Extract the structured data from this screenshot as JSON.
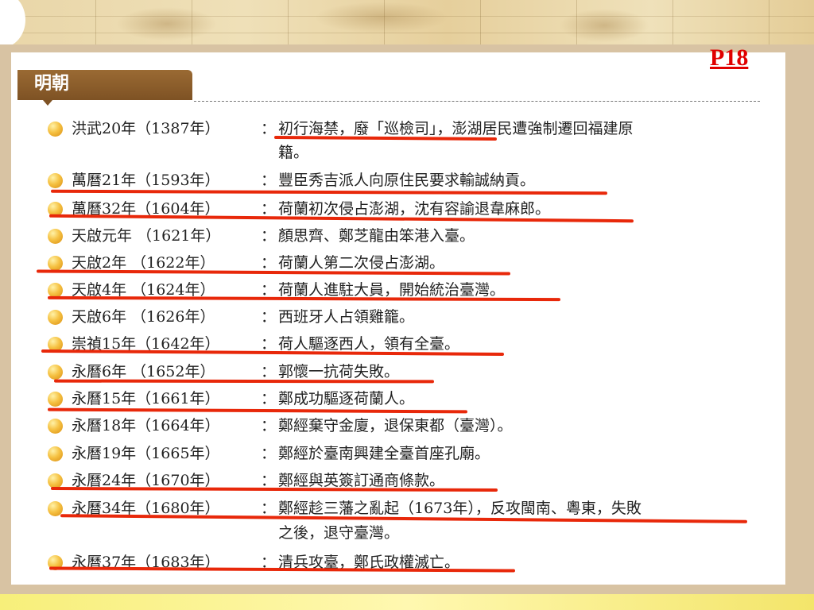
{
  "page_number": "P18",
  "section_title": "明朝",
  "colors": {
    "accent_red": "#e8280a",
    "tab_brown": "#8a5c2a",
    "bullet": "#f2b636"
  },
  "events": [
    {
      "date": "洪武20年（1387年）",
      "description": "初行海禁，廢「巡檢司」，澎湖居民遭強制遷回福建原",
      "continuation": "籍。"
    },
    {
      "date": "萬曆21年（1593年）",
      "description": "豐臣秀吉派人向原住民要求輸誠納貢。"
    },
    {
      "date": "萬曆32年（1604年）",
      "description": "荷蘭初次侵占澎湖，沈有容諭退韋麻郎。"
    },
    {
      "date": "天啟元年 （1621年）",
      "description": "顏思齊、鄭芝龍由笨港入臺。"
    },
    {
      "date": "天啟2年 （1622年）",
      "description": "荷蘭人第二次侵占澎湖。"
    },
    {
      "date": "天啟4年 （1624年）",
      "description": "荷蘭人進駐大員，開始統治臺灣。"
    },
    {
      "date": "天啟6年 （1626年）",
      "description": "西班牙人占領雞籠。"
    },
    {
      "date": "崇禎15年（1642年）",
      "description": "荷人驅逐西人，領有全臺。"
    },
    {
      "date": "永曆6年 （1652年）",
      "description": "郭懷一抗荷失敗。"
    },
    {
      "date": "永曆15年（1661年）",
      "description": "鄭成功驅逐荷蘭人。"
    },
    {
      "date": "永曆18年（1664年）",
      "description": "鄭經棄守金廈，退保東都（臺灣）。"
    },
    {
      "date": "永曆19年（1665年）",
      "description": "鄭經於臺南興建全臺首座孔廟。"
    },
    {
      "date": "永曆24年（1670年）",
      "description": "鄭經與英簽訂通商條款。"
    },
    {
      "date": "永曆34年（1680年）",
      "description": "鄭經趁三藩之亂起（1673年），反攻閩南、粵東，失敗",
      "continuation": "之後，退守臺灣。"
    },
    {
      "date": "永曆37年（1683年）",
      "description": "清兵攻臺，鄭氏政權滅亡。"
    }
  ]
}
